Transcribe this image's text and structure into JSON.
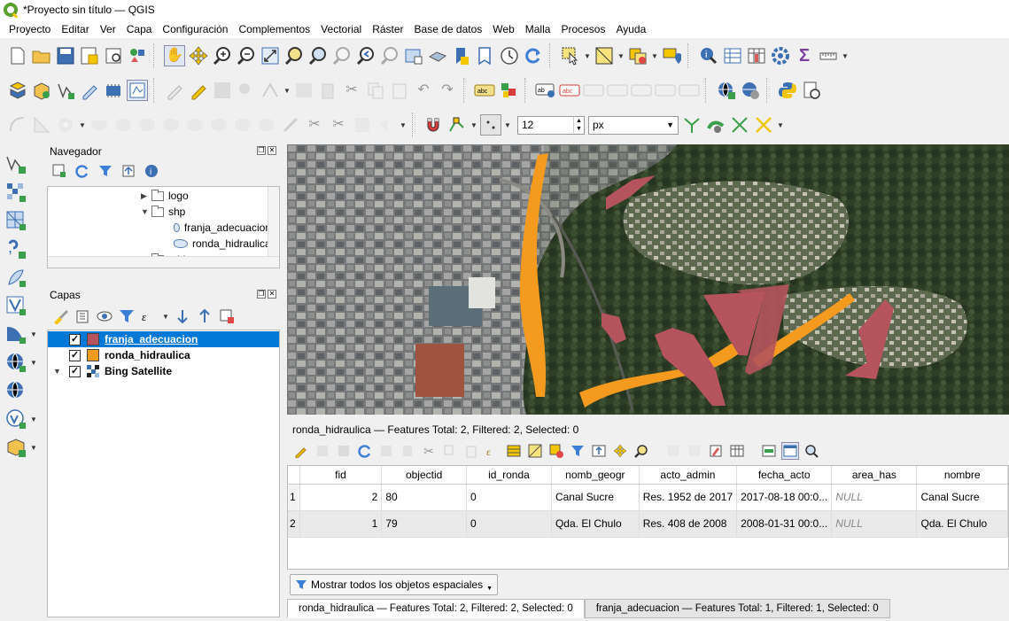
{
  "window": {
    "title": "*Proyecto sin título — QGIS"
  },
  "menu": [
    "Proyecto",
    "Editar",
    "Ver",
    "Capa",
    "Configuración",
    "Complementos",
    "Vectorial",
    "Ráster",
    "Base de datos",
    "Web",
    "Malla",
    "Procesos",
    "Ayuda"
  ],
  "snapping": {
    "tolerance": "12",
    "units": "px"
  },
  "browser": {
    "title": "Navegador",
    "items": [
      {
        "label": "logo",
        "type": "folder",
        "expanded": false
      },
      {
        "label": "shp",
        "type": "folder",
        "expanded": true
      },
      {
        "label": "franja_adecuacion",
        "type": "polygon-layer"
      },
      {
        "label": "ronda_hidraulica",
        "type": "polygon-layer"
      },
      {
        "label": "tablas",
        "type": "folder",
        "expanded": false
      }
    ]
  },
  "layers": {
    "title": "Capas",
    "items": [
      {
        "label": "franja_adecuacion",
        "checked": "✓",
        "color": "#b5545c",
        "selected": true
      },
      {
        "label": "ronda_hidraulica",
        "checked": "✓",
        "color": "#f39a1f",
        "selected": false
      },
      {
        "label": "Bing Satellite",
        "checked": "✓",
        "color": "",
        "selected": false
      }
    ]
  },
  "attribute_table": {
    "title": "ronda_hidraulica — Features Total: 2, Filtered: 2, Selected: 0",
    "columns": [
      "fid",
      "objectid",
      "id_ronda",
      "nomb_geogr",
      "acto_admin",
      "fecha_acto",
      "area_has",
      "nombre"
    ],
    "rows": [
      {
        "row": "1",
        "fid": "2",
        "objectid": "80",
        "id_ronda": "0",
        "nomb_geogr": "Canal Sucre",
        "acto_admin": "Res. 1952 de 2017",
        "fecha_acto": "2017-08-18 00:0...",
        "area_has": "NULL",
        "nombre": "Canal Sucre"
      },
      {
        "row": "2",
        "fid": "1",
        "objectid": "79",
        "id_ronda": "0",
        "nomb_geogr": "Qda. El Chulo",
        "acto_admin": "Res. 408 de 2008",
        "fecha_acto": "2008-01-31 00:0...",
        "area_has": "NULL",
        "nombre": "Qda. El Chulo"
      }
    ],
    "show_all_label": "Mostrar todos los objetos espaciales"
  },
  "tabs": [
    "ronda_hidraulica — Features Total: 2, Filtered: 2, Selected: 0",
    "franja_adecuacion — Features Total: 1, Filtered: 1, Selected: 0"
  ],
  "colors": {
    "selection": "#0078d7",
    "ronda": "#f39a1f",
    "franja": "#b5545c"
  }
}
